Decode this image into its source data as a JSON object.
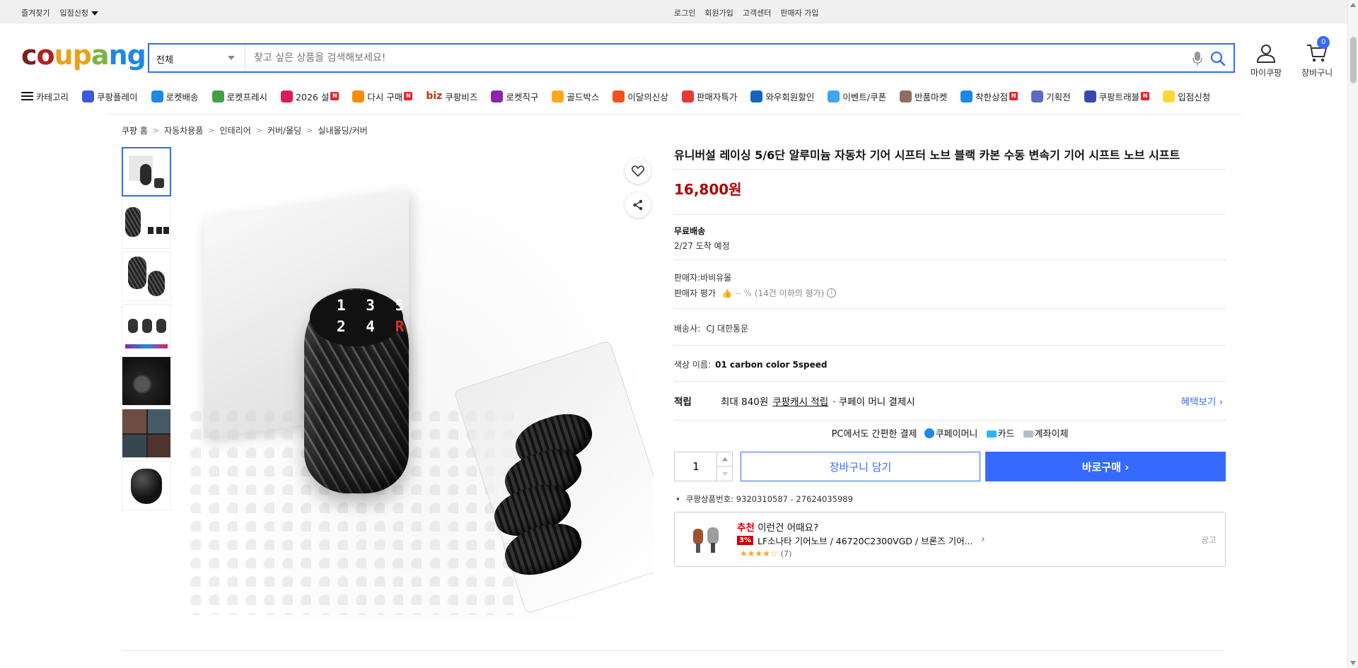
{
  "topbar": {
    "favorites": "즐겨찾기",
    "seller_apply": "입점신청",
    "login": "로그인",
    "signup": "회원가입",
    "customer_center": "고객센터",
    "seller_signup": "판매자 가입"
  },
  "header": {
    "logo": "coupang",
    "search_category": "전체",
    "search_placeholder": "찾고 싶은 상품을 검색해보세요!",
    "mycoupang": "마이쿠팡",
    "cart": "장바구니",
    "cart_count": "0"
  },
  "nav": {
    "category": "카테고리",
    "items": [
      {
        "label": "쿠팡플레이",
        "icon": "play-icon",
        "color": "#3b5bdb",
        "new": false
      },
      {
        "label": "로켓배송",
        "icon": "rocket-icon",
        "color": "#1e88e5",
        "new": false
      },
      {
        "label": "로켓프레시",
        "icon": "rocket-fresh-icon",
        "color": "#43a047",
        "new": false
      },
      {
        "label": "2026 설",
        "icon": "gift-icon",
        "color": "#d81b60",
        "new": true
      },
      {
        "label": "다시 구매",
        "icon": "rebuy-icon",
        "color": "#fb8c00",
        "new": true
      },
      {
        "label": "쿠팡비즈",
        "icon": "biz-icon",
        "color": "#bf360c",
        "new": false
      },
      {
        "label": "로켓직구",
        "icon": "global-icon",
        "color": "#8e24aa",
        "new": false
      },
      {
        "label": "골드박스",
        "icon": "goldbox-icon",
        "color": "#f9a825",
        "new": false
      },
      {
        "label": "이달의신상",
        "icon": "new-product-icon",
        "color": "#f4511e",
        "new": false
      },
      {
        "label": "판매자특가",
        "icon": "seller-deal-icon",
        "color": "#e53935",
        "new": false
      },
      {
        "label": "와우회원할인",
        "icon": "wow-icon",
        "color": "#1565c0",
        "new": false
      },
      {
        "label": "이벤트/쿠폰",
        "icon": "coupon-icon",
        "color": "#42a5f5",
        "new": false
      },
      {
        "label": "반품마켓",
        "icon": "return-market-icon",
        "color": "#8d6e63",
        "new": false
      },
      {
        "label": "착한상점",
        "icon": "store-icon",
        "color": "#1e88e5",
        "new": true
      },
      {
        "label": "기획전",
        "icon": "tag-icon",
        "color": "#5c6bc0",
        "new": false
      },
      {
        "label": "쿠팡트래블",
        "icon": "travel-icon",
        "color": "#3949ab",
        "new": true
      },
      {
        "label": "입점신청",
        "icon": "apply-icon",
        "color": "#fdd835",
        "new": false
      }
    ],
    "biz_prefix": "biz"
  },
  "breadcrumb": [
    "쿠팡 홈",
    "자동차용품",
    "인테리어",
    "커버/몰딩",
    "실내몰딩/커버"
  ],
  "product": {
    "knob_top": "1 3 5",
    "knob_bottom": "2 4",
    "knob_r": "R",
    "title": "유니버설 레이싱 5/6단 알루미늄 자동차 기어 시프터 노브 블랙 카본 수동 변속기 기어 시프트 노브 시프트",
    "price": "16,800원",
    "shipping_label": "무료배송",
    "arrival": "2/27 도착 예정",
    "seller": "판매자:바비유몰",
    "seller_rating_label": "판매자 평가",
    "seller_rating_value": "-- %",
    "seller_rating_note": "(14건 이하의 평가)",
    "carrier_label": "배송사:",
    "carrier": "CJ 대한통운",
    "option_label": "색상 이름:",
    "option_value": "01 carbon color 5speed",
    "points_label": "적립",
    "points_text": "최대 840원",
    "points_link": "쿠팡캐시 적립",
    "points_suffix": "· 쿠페이 머니 결제시",
    "benefits": "혜택보기",
    "pay_text": "PC에서도 간편한 결제",
    "pay_coupay": "쿠페이머니",
    "pay_card": "카드",
    "pay_bank": "계좌이체",
    "quantity": "1",
    "add_cart": "장바구니 담기",
    "buy_now": "바로구매",
    "product_no": "쿠팡상품번호: 9320310587 - 27624035989"
  },
  "recommend": {
    "prefix": "추천",
    "title": "이런건 어때요?",
    "discount": "3%",
    "item": "LF소나타 기어노브 / 46720C2300VGD / 브론즈 기어...",
    "stars": "★★★★☆",
    "count": "(7)",
    "ad": "광고"
  }
}
